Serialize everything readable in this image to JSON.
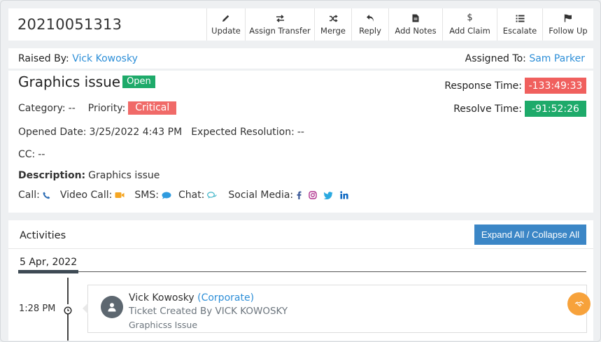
{
  "ticket_id": "20210051313",
  "toolbar": [
    {
      "label": "Update",
      "icon": "pencil-icon"
    },
    {
      "label": "Assign Transfer",
      "icon": "transfer-arrows-icon"
    },
    {
      "label": "Merge",
      "icon": "shuffle-icon"
    },
    {
      "label": "Reply",
      "icon": "reply-icon"
    },
    {
      "label": "Add Notes",
      "icon": "document-icon"
    },
    {
      "label": "Add Claim",
      "icon": "dollar-icon"
    },
    {
      "label": "Escalate",
      "icon": "list-icon"
    },
    {
      "label": "Follow Up",
      "icon": "flag-icon"
    }
  ],
  "raised_by": {
    "label": "Raised By:",
    "name": "Vick Kowosky"
  },
  "assigned_to": {
    "label": "Assigned To:",
    "name": "Sam Parker"
  },
  "details": {
    "title": "Graphics issue",
    "status": "Open",
    "response_label": "Response Time:",
    "response_time": "-133:49:33",
    "resolve_label": "Resolve Time:",
    "resolve_time": "-91:52:26",
    "category_label": "Category:",
    "category": "--",
    "priority_label": "Priority:",
    "priority": "Critical",
    "opened_label": "Opened Date:",
    "opened_date": "3/25/2022 4:43 PM",
    "expected_label": "Expected Resolution:",
    "expected": "--",
    "cc_label": "CC:",
    "cc": "--",
    "description_label": "Description:",
    "description": "Graphics issue",
    "call_label": "Call:",
    "video_label": "Video Call:",
    "sms_label": "SMS:",
    "chat_label": "Chat:",
    "social_label": "Social Media:"
  },
  "activities": {
    "title": "Activities",
    "expand_label": "Expand All / Collapse All",
    "date": "5 Apr, 2022",
    "items": [
      {
        "time": "1:28 PM",
        "name": "Vick Kowosky",
        "org": "(Corporate)",
        "line2": "Ticket Created By VICK KOWOSKY",
        "line3": "Graphicss Issue"
      }
    ]
  },
  "colors": {
    "open": "#1eaa6a",
    "critical": "#f06a68",
    "response": "#f0605e",
    "resolve": "#1eaa6a",
    "link": "#2e8fd8",
    "expand": "#3b86c6",
    "action": "#f7a23b"
  }
}
